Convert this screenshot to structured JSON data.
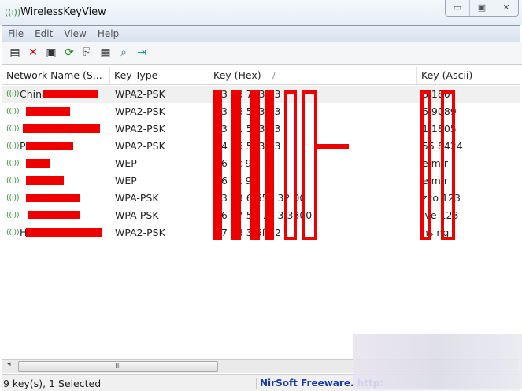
{
  "window": {
    "title": "WirelessKeyView",
    "minimize": "▭",
    "maximize": "▣",
    "close": "✕"
  },
  "menu": [
    "File",
    "Edit",
    "View",
    "Help"
  ],
  "toolbar": [
    {
      "icon": "properties-icon",
      "glyph": "▤"
    },
    {
      "icon": "delete-icon",
      "glyph": "✕"
    },
    {
      "icon": "save-icon",
      "glyph": "▣"
    },
    {
      "icon": "refresh-icon",
      "glyph": "⟳"
    },
    {
      "icon": "copy-icon",
      "glyph": "⎘"
    },
    {
      "icon": "report-icon",
      "glyph": "▦"
    },
    {
      "icon": "find-icon",
      "glyph": "⌕"
    },
    {
      "icon": "exit-icon",
      "glyph": "⇥"
    }
  ],
  "columns": [
    "Network Name (S...",
    "Key Type",
    "Key (Hex)",
    "Key (Ascii)"
  ],
  "sort_indicator": "/",
  "rows": [
    {
      "name": "China",
      "type": "WPA2-PSK",
      "hex": "53 38 7. 31 3",
      "ascii": "  8  180"
    },
    {
      "name": "",
      "type": "WPA2-PSK",
      "hex": "33 36 5. 39 3",
      "ascii": "  6 9089"
    },
    {
      "name": "",
      "type": "WPA2-PSK",
      "hex": "33 31 5. 33 3",
      "ascii": "  1 1805"
    },
    {
      "name": "P",
      "type": "WPA2-PSK",
      "hex": "04 36 5. 33 3",
      "ascii": "  55  8424"
    },
    {
      "name": "",
      "type": "WEP",
      "hex": "16 6c 9",
      "ascii": "  e m r"
    },
    {
      "name": "",
      "type": "WEP",
      "hex": "16 6c 9",
      "ascii": "  e m r"
    },
    {
      "name": "",
      "type": "WPA-PSK",
      "hex": "33 53 6 653 32 00",
      "ascii": "  zco 123"
    },
    {
      "name": "",
      "type": "WPA-PSK",
      "hex": "36 77 56 74 3 3300",
      "ascii": "  ive 123"
    },
    {
      "name": "H",
      "type": "WPA2-PSK",
      "hex": "37 58 3 6f 52",
      "ascii": "  ns  ng"
    }
  ],
  "status": {
    "count": "9 key(s), 1 Selected",
    "credit": "NirSoft Freeware.  http:"
  },
  "colors": {
    "redaction": "#ee0000",
    "link": "#1a3aa8"
  }
}
